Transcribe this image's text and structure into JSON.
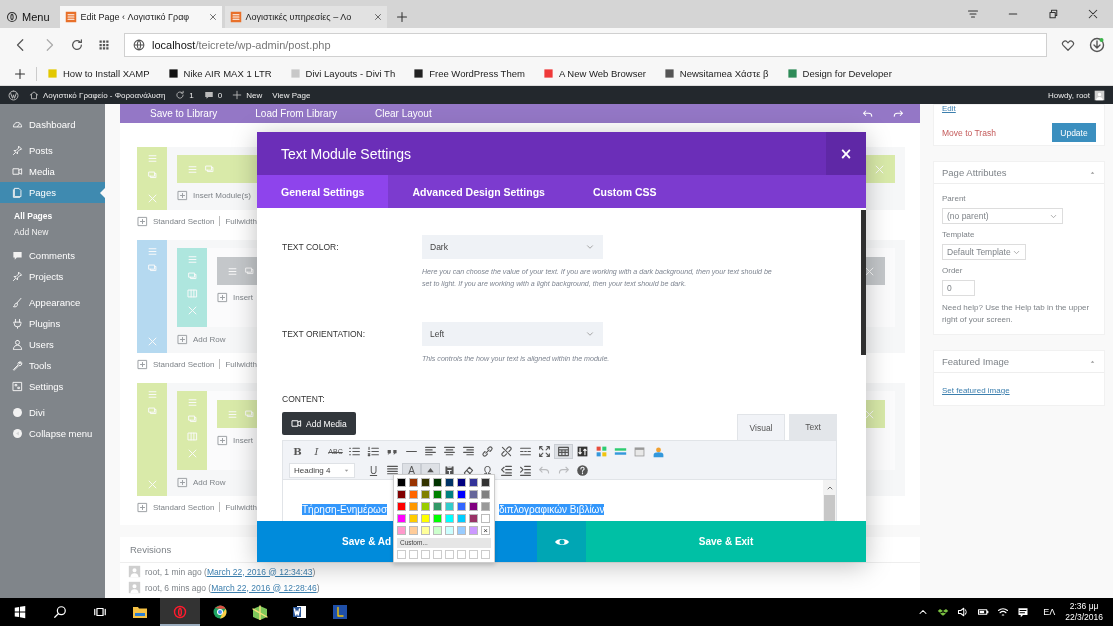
{
  "browser": {
    "menu_label": "Menu",
    "tabs": [
      {
        "label": "Edit Page ‹ Λογιστικό Γραφ",
        "selected": true
      },
      {
        "label": "Λογιστικές υπηρεσίες – Λο",
        "selected": false
      }
    ],
    "address": {
      "host": "localhost",
      "path": "/teicrete/wp-admin/post.php"
    },
    "bookmarks": [
      {
        "label": "How to Install XAMP",
        "color": "#e3c800"
      },
      {
        "label": "Nike AIR MAX 1 LTR",
        "color": "#111111"
      },
      {
        "label": "Divi Layouts - Divi Th",
        "color": "#c8c8c8"
      },
      {
        "label": "Free WordPress Them",
        "color": "#222222"
      },
      {
        "label": "A New Web Browser",
        "color": "#ef3939"
      },
      {
        "label": "Newsitamea Χάστε β",
        "color": "#555555"
      },
      {
        "label": "Design for Developer",
        "color": "#2e8b57"
      }
    ]
  },
  "admin_bar": {
    "site": "Λογιστικό Γραφείο - Φοροανάλυση",
    "updates": "1",
    "comments": "0",
    "new": "New",
    "view": "View Page",
    "howdy": "Howdy, root"
  },
  "sidebar": {
    "groups": [
      [
        {
          "label": "Dashboard",
          "kind": "dashboard",
          "selected": false
        }
      ],
      [
        {
          "label": "Posts",
          "kind": "pin",
          "selected": false
        },
        {
          "label": "Media",
          "kind": "media",
          "selected": false
        },
        {
          "label": "Pages",
          "kind": "pages",
          "selected": true,
          "children": [
            {
              "label": "All Pages",
              "selected": true
            },
            {
              "label": "Add New",
              "selected": false
            }
          ]
        }
      ],
      [
        {
          "label": "Comments",
          "kind": "comment",
          "selected": false
        },
        {
          "label": "Projects",
          "kind": "pin",
          "selected": false
        }
      ],
      [
        {
          "label": "Appearance",
          "kind": "brush",
          "selected": false
        },
        {
          "label": "Plugins",
          "kind": "plug",
          "selected": false
        },
        {
          "label": "Users",
          "kind": "user",
          "selected": false
        },
        {
          "label": "Tools",
          "kind": "wrench",
          "selected": false
        },
        {
          "label": "Settings",
          "kind": "settings",
          "selected": false
        }
      ],
      [
        {
          "label": "Divi",
          "kind": "divi",
          "selected": false
        },
        {
          "label": "Collapse menu",
          "kind": "collapse",
          "selected": false
        }
      ]
    ]
  },
  "builder": {
    "actions": [
      "Save to Library",
      "Load From Library",
      "Clear Layout"
    ],
    "sections": [
      {
        "color": "#d9eaa9",
        "module": {
          "color": "#d9eaa9"
        },
        "insert": "Insert Module(s)",
        "standard": "Standard Section",
        "fullwidth": "Fullwidth"
      },
      {
        "color": "#b5d9f0",
        "row": {
          "color": "#aee6de"
        },
        "module": {
          "color": "#c4c7ca"
        },
        "insert": "Insert",
        "add_row": "Add Row",
        "standard": "Standard Section",
        "fullwidth": "Fullwidth"
      },
      {
        "color": "#d9eaa9",
        "row": {
          "color": "#d9eaa9"
        },
        "module": {
          "color": "#d9eaa9"
        },
        "insert": "Insert",
        "add_row": "Add Row",
        "standard": "Standard Section",
        "fullwidth": "Fullwidth"
      }
    ]
  },
  "revisions": {
    "title": "Revisions",
    "rows": [
      {
        "prefix": "root, 1 min ago (",
        "link": "March 22, 2016 @ 12:34:43",
        "suffix": ")"
      },
      {
        "prefix": "root, 6 mins ago (",
        "link": "March 22, 2016 @ 12:28:46",
        "suffix": ")"
      }
    ]
  },
  "publish": {
    "edit": "Edit",
    "trash": "Move to Trash",
    "update": "Update"
  },
  "page_attributes": {
    "title": "Page Attributes",
    "parent_label": "Parent",
    "parent": "(no parent)",
    "template_label": "Template",
    "template": "Default Template",
    "order_label": "Order",
    "order": "0",
    "help": "Need help? Use the Help tab in the upper right of your screen."
  },
  "featured": {
    "title": "Featured Image",
    "link": "Set featured image"
  },
  "modal": {
    "title": "Text Module Settings",
    "close": "×",
    "tabs": [
      {
        "label": "General Settings",
        "selected": true
      },
      {
        "label": "Advanced Design Settings",
        "selected": false
      },
      {
        "label": "Custom CSS",
        "selected": false
      }
    ],
    "fields": [
      {
        "label": "TEXT COLOR:",
        "value": "Dark",
        "help": "Here you can choose the value of your text. If you are working with a dark background, then your text should be set to light. If you are working with a light background, then your text should be dark."
      },
      {
        "label": "TEXT ORIENTATION:",
        "value": "Left",
        "help": "This controls the how your text is aligned within the module."
      }
    ],
    "content": {
      "label": "CONTENT:",
      "add_media": "Add Media",
      "editor_tabs": [
        {
          "label": "Visual",
          "selected": true
        },
        {
          "label": "Text",
          "selected": false
        }
      ],
      "toolbar_rows": [
        [
          {
            "kind": "bold",
            "glyph": "B",
            "on": false,
            "disabled": false
          },
          {
            "kind": "italic",
            "glyph": "I",
            "on": false,
            "disabled": false
          },
          {
            "kind": "strikethrough",
            "glyph": "ABC",
            "on": false,
            "disabled": false
          },
          {
            "kind": "bullet-list",
            "on": false,
            "disabled": false
          },
          {
            "kind": "numbered-list",
            "on": false,
            "disabled": false
          },
          {
            "kind": "quote",
            "on": false,
            "disabled": false
          },
          {
            "kind": "horizontal-line",
            "on": false,
            "disabled": false
          },
          {
            "kind": "align-left",
            "on": false,
            "disabled": false
          },
          {
            "kind": "align-center",
            "on": false,
            "disabled": false
          },
          {
            "kind": "align-right",
            "on": false,
            "disabled": false
          },
          {
            "kind": "link",
            "on": false,
            "disabled": false
          },
          {
            "kind": "unlink",
            "on": false,
            "disabled": false
          },
          {
            "kind": "read-more",
            "on": false,
            "disabled": false
          },
          {
            "kind": "fullscreen",
            "on": false,
            "disabled": false
          },
          {
            "kind": "toolbar-toggle",
            "on": true,
            "disabled": false
          },
          {
            "kind": "sort",
            "on": false,
            "disabled": false
          },
          {
            "kind": "grid",
            "on": false,
            "disabled": false
          },
          {
            "kind": "bars",
            "on": false,
            "disabled": false
          },
          {
            "kind": "calendar",
            "on": false,
            "disabled": false
          },
          {
            "kind": "person",
            "on": false,
            "disabled": false
          }
        ],
        [
          {
            "kind": "underline",
            "glyph": "U",
            "on": false,
            "disabled": false
          },
          {
            "kind": "justify",
            "on": false,
            "disabled": false
          },
          {
            "kind": "text-color",
            "glyph": "A",
            "on": true,
            "disabled": false
          },
          {
            "kind": "caret",
            "on": true,
            "disabled": false
          },
          {
            "kind": "clipboard",
            "on": false,
            "disabled": false
          },
          {
            "kind": "eraser",
            "on": false,
            "disabled": false
          },
          {
            "kind": "special-character",
            "glyph": "Ω",
            "on": false,
            "disabled": false
          },
          {
            "kind": "outdent",
            "on": false,
            "disabled": false
          },
          {
            "kind": "indent",
            "on": false,
            "disabled": false
          },
          {
            "kind": "undo",
            "on": false,
            "disabled": true
          },
          {
            "kind": "redo",
            "on": false,
            "disabled": true
          },
          {
            "kind": "help",
            "on": false,
            "disabled": false
          }
        ]
      ],
      "format": "Heading 4",
      "text_before": "Τήρηση-Ενημέρωσ",
      "text_after": "διπλογραφικών Βιβλίων"
    },
    "save_add": "Save & Ad",
    "save_exit": "Save & Exit"
  },
  "color_picker": {
    "swatches": [
      {
        "color": "#000000"
      },
      {
        "color": "#993300"
      },
      {
        "color": "#333300"
      },
      {
        "color": "#003300"
      },
      {
        "color": "#003366"
      },
      {
        "color": "#000080"
      },
      {
        "color": "#333399"
      },
      {
        "color": "#333333"
      },
      {
        "color": "#800000"
      },
      {
        "color": "#ff6600"
      },
      {
        "color": "#808000"
      },
      {
        "color": "#008000"
      },
      {
        "color": "#008080"
      },
      {
        "color": "#0000ff"
      },
      {
        "color": "#666699"
      },
      {
        "color": "#808080"
      },
      {
        "color": "#ff0000"
      },
      {
        "color": "#ff9900"
      },
      {
        "color": "#99cc00"
      },
      {
        "color": "#339966"
      },
      {
        "color": "#33cccc"
      },
      {
        "color": "#3366ff"
      },
      {
        "color": "#800080"
      },
      {
        "color": "#999999"
      },
      {
        "color": "#ff00ff"
      },
      {
        "color": "#ffcc00"
      },
      {
        "color": "#ffff00"
      },
      {
        "color": "#00ff00"
      },
      {
        "color": "#00ffff"
      },
      {
        "color": "#00ccff"
      },
      {
        "color": "#993366"
      },
      {
        "color": "#ffffff"
      },
      {
        "color": "#ff99cc"
      },
      {
        "color": "#ffcc99"
      },
      {
        "color": "#ffff99"
      },
      {
        "color": "#ccffcc"
      },
      {
        "color": "#ccffff"
      },
      {
        "color": "#99ccff"
      },
      {
        "color": "#cc99ff"
      }
    ],
    "remove": "×",
    "custom": "Custom..."
  },
  "taskbar": {
    "apps": [
      {
        "kind": "explorer",
        "selected": false
      },
      {
        "kind": "opera",
        "selected": true
      },
      {
        "kind": "chrome",
        "selected": false
      },
      {
        "kind": "maps",
        "selected": false
      },
      {
        "kind": "word",
        "selected": false
      },
      {
        "kind": "launcher",
        "selected": false
      }
    ],
    "lang": "ΕΛ",
    "time": "2:36 μμ",
    "date": "22/3/2016"
  }
}
